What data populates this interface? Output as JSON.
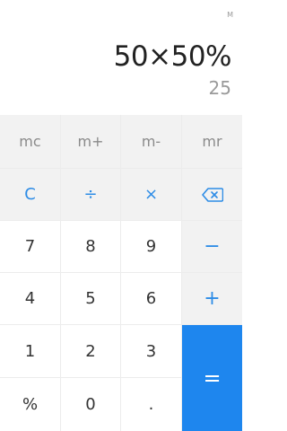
{
  "display": {
    "memory_indicator": "M",
    "expression": "50×50%",
    "result": "25"
  },
  "memory_keys": {
    "mc": "mc",
    "m_plus": "m+",
    "m_minus": "m-",
    "mr": "mr"
  },
  "function_keys": {
    "clear": "C",
    "divide": "÷",
    "multiply": "×",
    "backspace_icon": "backspace-icon"
  },
  "number_keys": {
    "seven": "7",
    "eight": "8",
    "nine": "9",
    "four": "4",
    "five": "5",
    "six": "6",
    "one": "1",
    "two": "2",
    "three": "3",
    "zero": "0"
  },
  "operator_keys": {
    "minus": "−",
    "plus": "+",
    "equals": "="
  },
  "misc_keys": {
    "percent": "%",
    "decimal": "."
  },
  "colors": {
    "accent": "#1e86ee",
    "operator_text": "#2d8ce6",
    "secondary_bg": "#f2f2f2"
  }
}
